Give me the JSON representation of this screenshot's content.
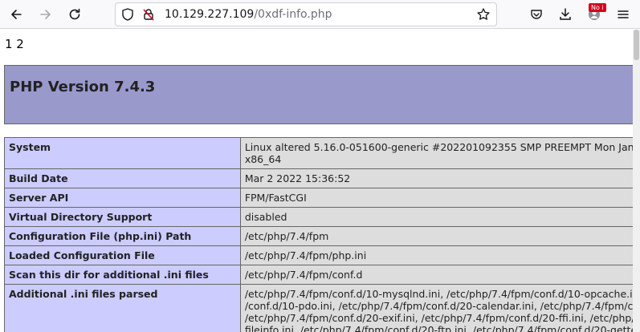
{
  "browser": {
    "url_host": "10.129.227.109",
    "url_path": "/0xdf-info.php",
    "badge_text": "No i",
    "icons": [
      "back-arrow-icon",
      "forward-arrow-icon",
      "reload-icon",
      "shield-icon",
      "insecure-lock-icon",
      "bookmark-star-icon",
      "pocket-icon",
      "download-icon",
      "account-icon",
      "hamburger-menu-icon"
    ]
  },
  "page": {
    "pager": "1 2",
    "php_version_title": "PHP Version 7.4.3",
    "rows": [
      {
        "label": "System",
        "lines": [
          "Linux altered 5.16.0-051600-generic #202201092355 SMP PREEMPT Mon Jan",
          "x86_64"
        ]
      },
      {
        "label": "Build Date",
        "lines": [
          "Mar 2 2022 15:36:52"
        ]
      },
      {
        "label": "Server API",
        "lines": [
          "FPM/FastCGI"
        ]
      },
      {
        "label": "Virtual Directory Support",
        "lines": [
          "disabled"
        ]
      },
      {
        "label": "Configuration File (php.ini) Path",
        "lines": [
          "/etc/php/7.4/fpm"
        ]
      },
      {
        "label": "Loaded Configuration File",
        "lines": [
          "/etc/php/7.4/fpm/php.ini"
        ]
      },
      {
        "label": "Scan this dir for additional .ini files",
        "lines": [
          "/etc/php/7.4/fpm/conf.d"
        ]
      },
      {
        "label": "Additional .ini files parsed",
        "lines": [
          "/etc/php/7.4/fpm/conf.d/10-mysqlnd.ini, /etc/php/7.4/fpm/conf.d/10-opcache.ini",
          "/conf.d/10-pdo.ini, /etc/php/7.4/fpm/conf.d/20-calendar.ini, /etc/php/7.4/fpm/co",
          "/etc/php/7.4/fpm/conf.d/20-exif.ini, /etc/php/7.4/fpm/conf.d/20-ffi.ini, /etc/php/7",
          "fileinfo.ini, /etc/php/7.4/fpm/conf.d/20-ftp.ini, /etc/php/7.4/fpm/conf.d/20-gette"
        ]
      }
    ]
  },
  "colors": {
    "header_bg": "#9999cc",
    "label_bg": "#ccccff",
    "value_bg": "#dddddd",
    "badge_bg": "#d70022"
  }
}
